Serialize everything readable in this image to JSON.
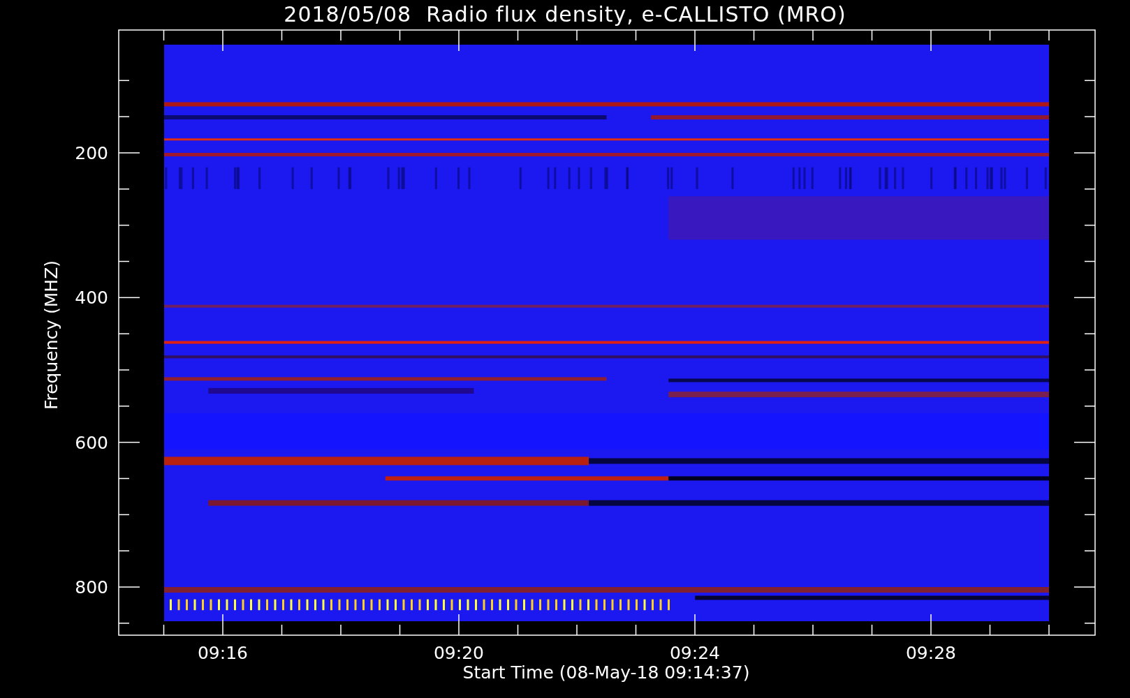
{
  "title": "2018/05/08  Radio flux density, e-CALLISTO (MRO)",
  "y_axis": {
    "label": "Frequency (MHZ)",
    "ticks": [
      "200",
      "400",
      "600",
      "800"
    ]
  },
  "x_axis": {
    "label": "Start Time (08-May-18 09:14:37)",
    "ticks": [
      "09:16",
      "09:20",
      "09:24",
      "09:28"
    ]
  }
}
